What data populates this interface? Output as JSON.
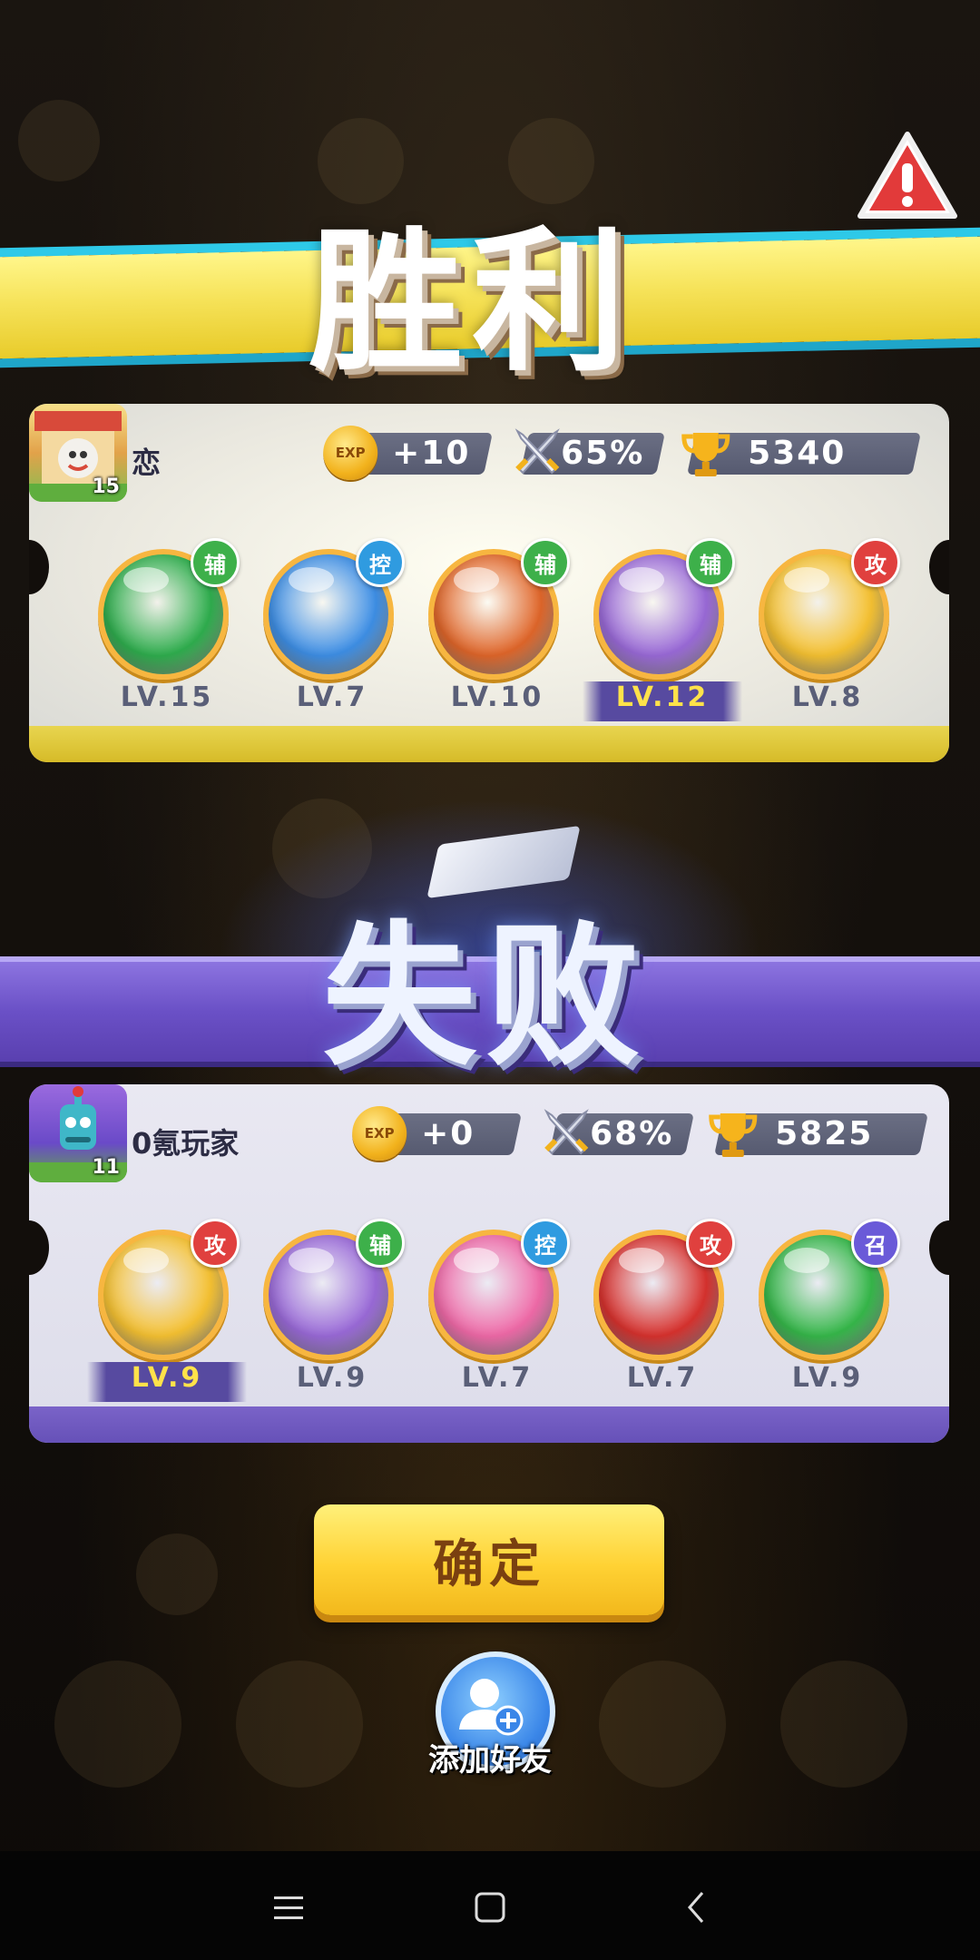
{
  "victory": {
    "title": "胜利"
  },
  "defeat": {
    "title": "失败"
  },
  "winner": {
    "name": "恋",
    "avatar_level": "15",
    "exp": "+10",
    "win_rate": "65%",
    "trophies": "5340",
    "units": [
      {
        "role": "辅",
        "level": "LV.15",
        "orb_color": "#2fae4e",
        "highlight": false
      },
      {
        "role": "控",
        "level": "LV.7",
        "orb_color": "#3e8fe6",
        "highlight": false
      },
      {
        "role": "辅",
        "level": "LV.10",
        "orb_color": "#e0662a",
        "highlight": false
      },
      {
        "role": "辅",
        "level": "LV.12",
        "orb_color": "#9a6ad8",
        "highlight": true
      },
      {
        "role": "攻",
        "level": "LV.8",
        "orb_color": "#f6c232",
        "highlight": false
      }
    ]
  },
  "loser": {
    "name": "0氪玩家",
    "avatar_level": "11",
    "exp": "+0",
    "win_rate": "68%",
    "trophies": "5825",
    "units": [
      {
        "role": "攻",
        "level": "LV.9",
        "orb_color": "#f6c232",
        "highlight": true
      },
      {
        "role": "辅",
        "level": "LV.9",
        "orb_color": "#9a6ad8",
        "highlight": false
      },
      {
        "role": "控",
        "level": "LV.7",
        "orb_color": "#f06aa8",
        "highlight": false
      },
      {
        "role": "攻",
        "level": "LV.7",
        "orb_color": "#d8322e",
        "highlight": false
      },
      {
        "role": "召",
        "level": "LV.9",
        "orb_color": "#36b84a",
        "highlight": false
      }
    ]
  },
  "exp_icon_text": "EXP",
  "confirm_label": "确定",
  "add_friend_label": "添加好友",
  "icons": {
    "warning": "warning-triangle-icon",
    "sword": "crossed-swords-icon",
    "trophy": "trophy-icon",
    "add_friend": "add-friend-icon"
  },
  "colors": {
    "victory_yellow": "#f6e35a",
    "defeat_purple": "#6a50c6",
    "button_yellow": "#ffd234",
    "role_fu": "#3db04a",
    "role_kong": "#2f9be0",
    "role_gong": "#e0403e",
    "role_zhao": "#6a5ad8"
  }
}
